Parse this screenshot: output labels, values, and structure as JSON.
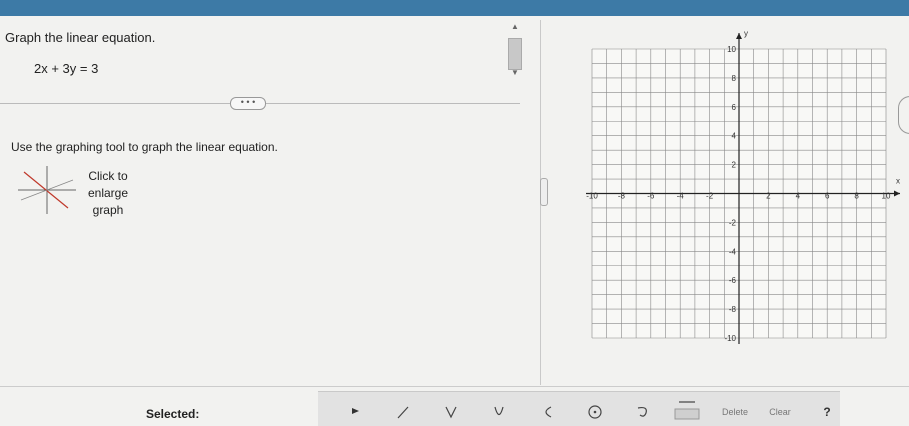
{
  "question": {
    "prompt": "Graph the linear equation.",
    "equation": "2x + 3y = 3",
    "expand_label": "• • •",
    "instruction": "Use the graphing tool to graph the linear equation.",
    "enlarge_label": "Click to enlarge graph"
  },
  "graph": {
    "x_axis_label": "x",
    "y_axis_label": "y",
    "x_ticks": [
      "-10",
      "-8",
      "-6",
      "-4",
      "-2",
      "2",
      "4",
      "6",
      "8",
      "10"
    ],
    "y_ticks": [
      "10",
      "8",
      "6",
      "4",
      "2",
      "-2",
      "-4",
      "-6",
      "-8",
      "-10"
    ],
    "range": {
      "x": [
        -10,
        10
      ],
      "y": [
        -10,
        10
      ]
    }
  },
  "toolbar": {
    "selected_label": "Selected:",
    "tools": [
      "point-tool",
      "line-tool",
      "parabola-tool",
      "u-shape-tool",
      "curve-tool",
      "circle-tool",
      "loop-tool",
      "fill-tool"
    ],
    "delete_label": "Delete",
    "clear_label": "Clear",
    "help_label": "?"
  },
  "colors": {
    "top_bar": "#3d7aa6",
    "grid": "#888888",
    "axis": "#222222",
    "sample_line_red": "#c0392b"
  }
}
